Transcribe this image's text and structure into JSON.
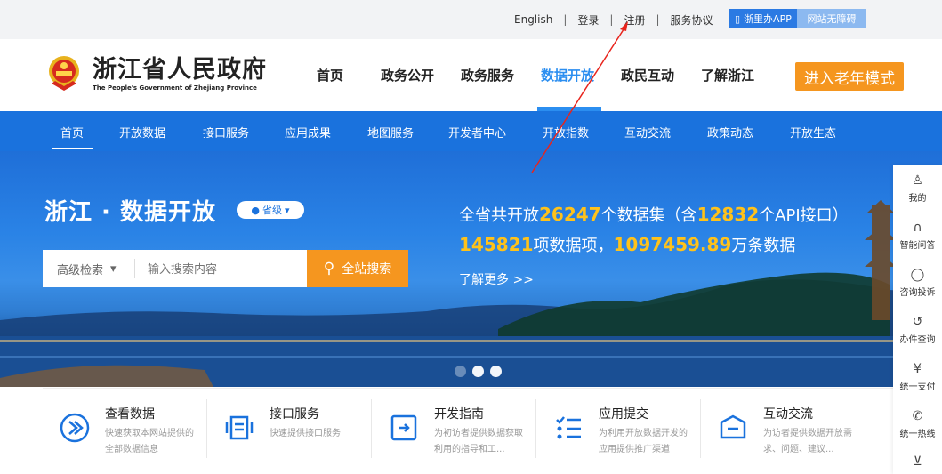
{
  "topbar": {
    "links": [
      "English",
      "登录",
      "注册",
      "服务协议"
    ],
    "app_button": "浙里办APP",
    "accessibility_button": "网站无障碍"
  },
  "header": {
    "site_name": "浙江省人民政府",
    "site_name_en": "The People's Government of Zhejiang Province",
    "nav": [
      "首页",
      "政务公开",
      "政务服务",
      "数据开放",
      "政民互动",
      "了解浙江"
    ],
    "active_nav": "数据开放",
    "elder_mode_button": "进入老年模式"
  },
  "subnav": {
    "items": [
      "首页",
      "开放数据",
      "接口服务",
      "应用成果",
      "地图服务",
      "开发者中心",
      "开放指数",
      "互动交流",
      "政策动态",
      "开放生态"
    ],
    "active": "首页"
  },
  "hero": {
    "title": "浙江 · 数据开放",
    "level_pill": "省级",
    "search": {
      "advanced_label": "高级检索",
      "placeholder": "输入搜索内容",
      "button": "全站搜索"
    },
    "stats": {
      "prefix": "全省共开放",
      "datasets": "26247",
      "mid1": "个数据集（含",
      "apis": "12832",
      "suffix1": "个API接口）",
      "items": "145821",
      "mid2": "项数据项，",
      "records": "1097459.89",
      "suffix2": "万条数据"
    },
    "learn_more": "了解更多  >>"
  },
  "cards": [
    {
      "title": "查看数据",
      "desc": "快速获取本网站提供的全部数据信息",
      "icon": "data-view-icon"
    },
    {
      "title": "接口服务",
      "desc": "快速提供接口服务",
      "icon": "api-service-icon"
    },
    {
      "title": "开发指南",
      "desc": "为初访者提供数据获取利用的指导和工...",
      "icon": "dev-guide-icon"
    },
    {
      "title": "应用提交",
      "desc": "为利用开放数据开发的应用提供推广渠道",
      "icon": "app-submit-icon"
    },
    {
      "title": "互动交流",
      "desc": "为访者提供数据开放需求、问题、建议...",
      "icon": "interaction-icon"
    }
  ],
  "rail": [
    {
      "label": "我的",
      "icon": "user-icon"
    },
    {
      "label": "智能问答",
      "icon": "headset-icon"
    },
    {
      "label": "咨询投诉",
      "icon": "shield-icon"
    },
    {
      "label": "办件查询",
      "icon": "history-icon"
    },
    {
      "label": "统一支付",
      "icon": "yen-icon"
    },
    {
      "label": "统一热线",
      "icon": "phone-icon"
    },
    {
      "label": "",
      "icon": "download-icon"
    }
  ],
  "colors": {
    "brand_blue": "#1a72dd",
    "accent_orange": "#f5961f",
    "highlight_yellow": "#ffc21a",
    "active_nav": "#2b8ef0"
  }
}
